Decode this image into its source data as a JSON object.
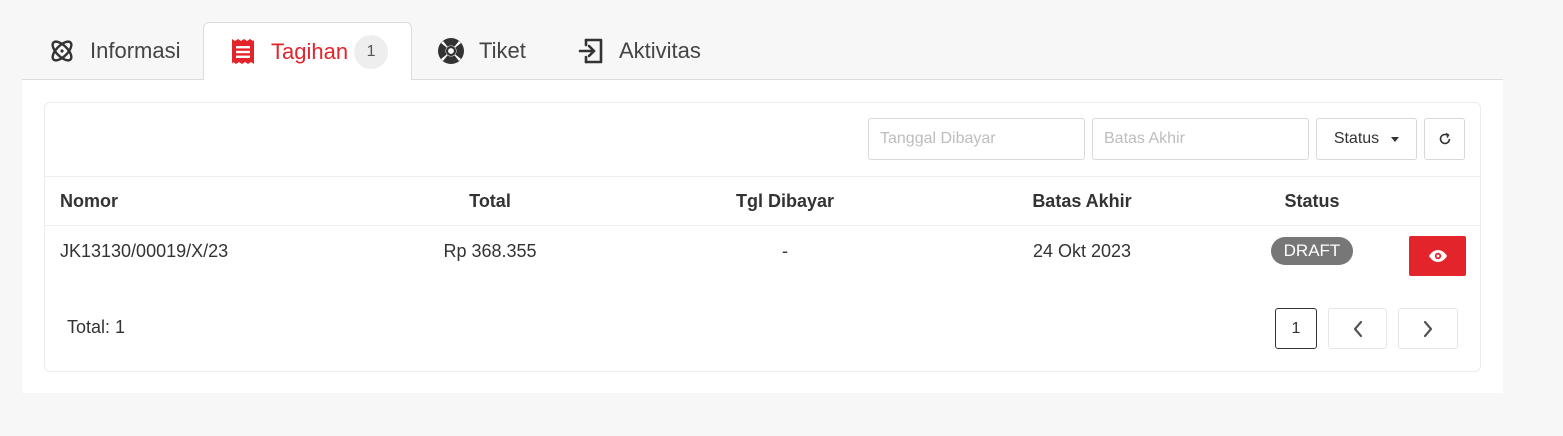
{
  "tabs": [
    {
      "label": "Informasi",
      "icon": "atom-icon",
      "active": false
    },
    {
      "label": "Tagihan",
      "icon": "receipt-icon",
      "active": true,
      "badge": "1"
    },
    {
      "label": "Tiket",
      "icon": "lifebuoy-icon",
      "active": false
    },
    {
      "label": "Aktivitas",
      "icon": "sign-in-icon",
      "active": false
    }
  ],
  "filters": {
    "tanggal_dibayar_placeholder": "Tanggal Dibayar",
    "batas_akhir_placeholder": "Batas Akhir",
    "status_label": "Status"
  },
  "table": {
    "headers": [
      "Nomor",
      "Total",
      "Tgl Dibayar",
      "Batas Akhir",
      "Status"
    ],
    "rows": [
      {
        "nomor": "JK13130/00019/X/23",
        "total": "Rp 368.355",
        "tgl_dibayar": "-",
        "batas_akhir": "24 Okt 2023",
        "status": "DRAFT"
      }
    ]
  },
  "footer": {
    "total_text": "Total: 1",
    "current_page": "1"
  },
  "colors": {
    "accent": "#e3242b",
    "draft_badge": "#777777",
    "background": "#f7f7f7"
  }
}
